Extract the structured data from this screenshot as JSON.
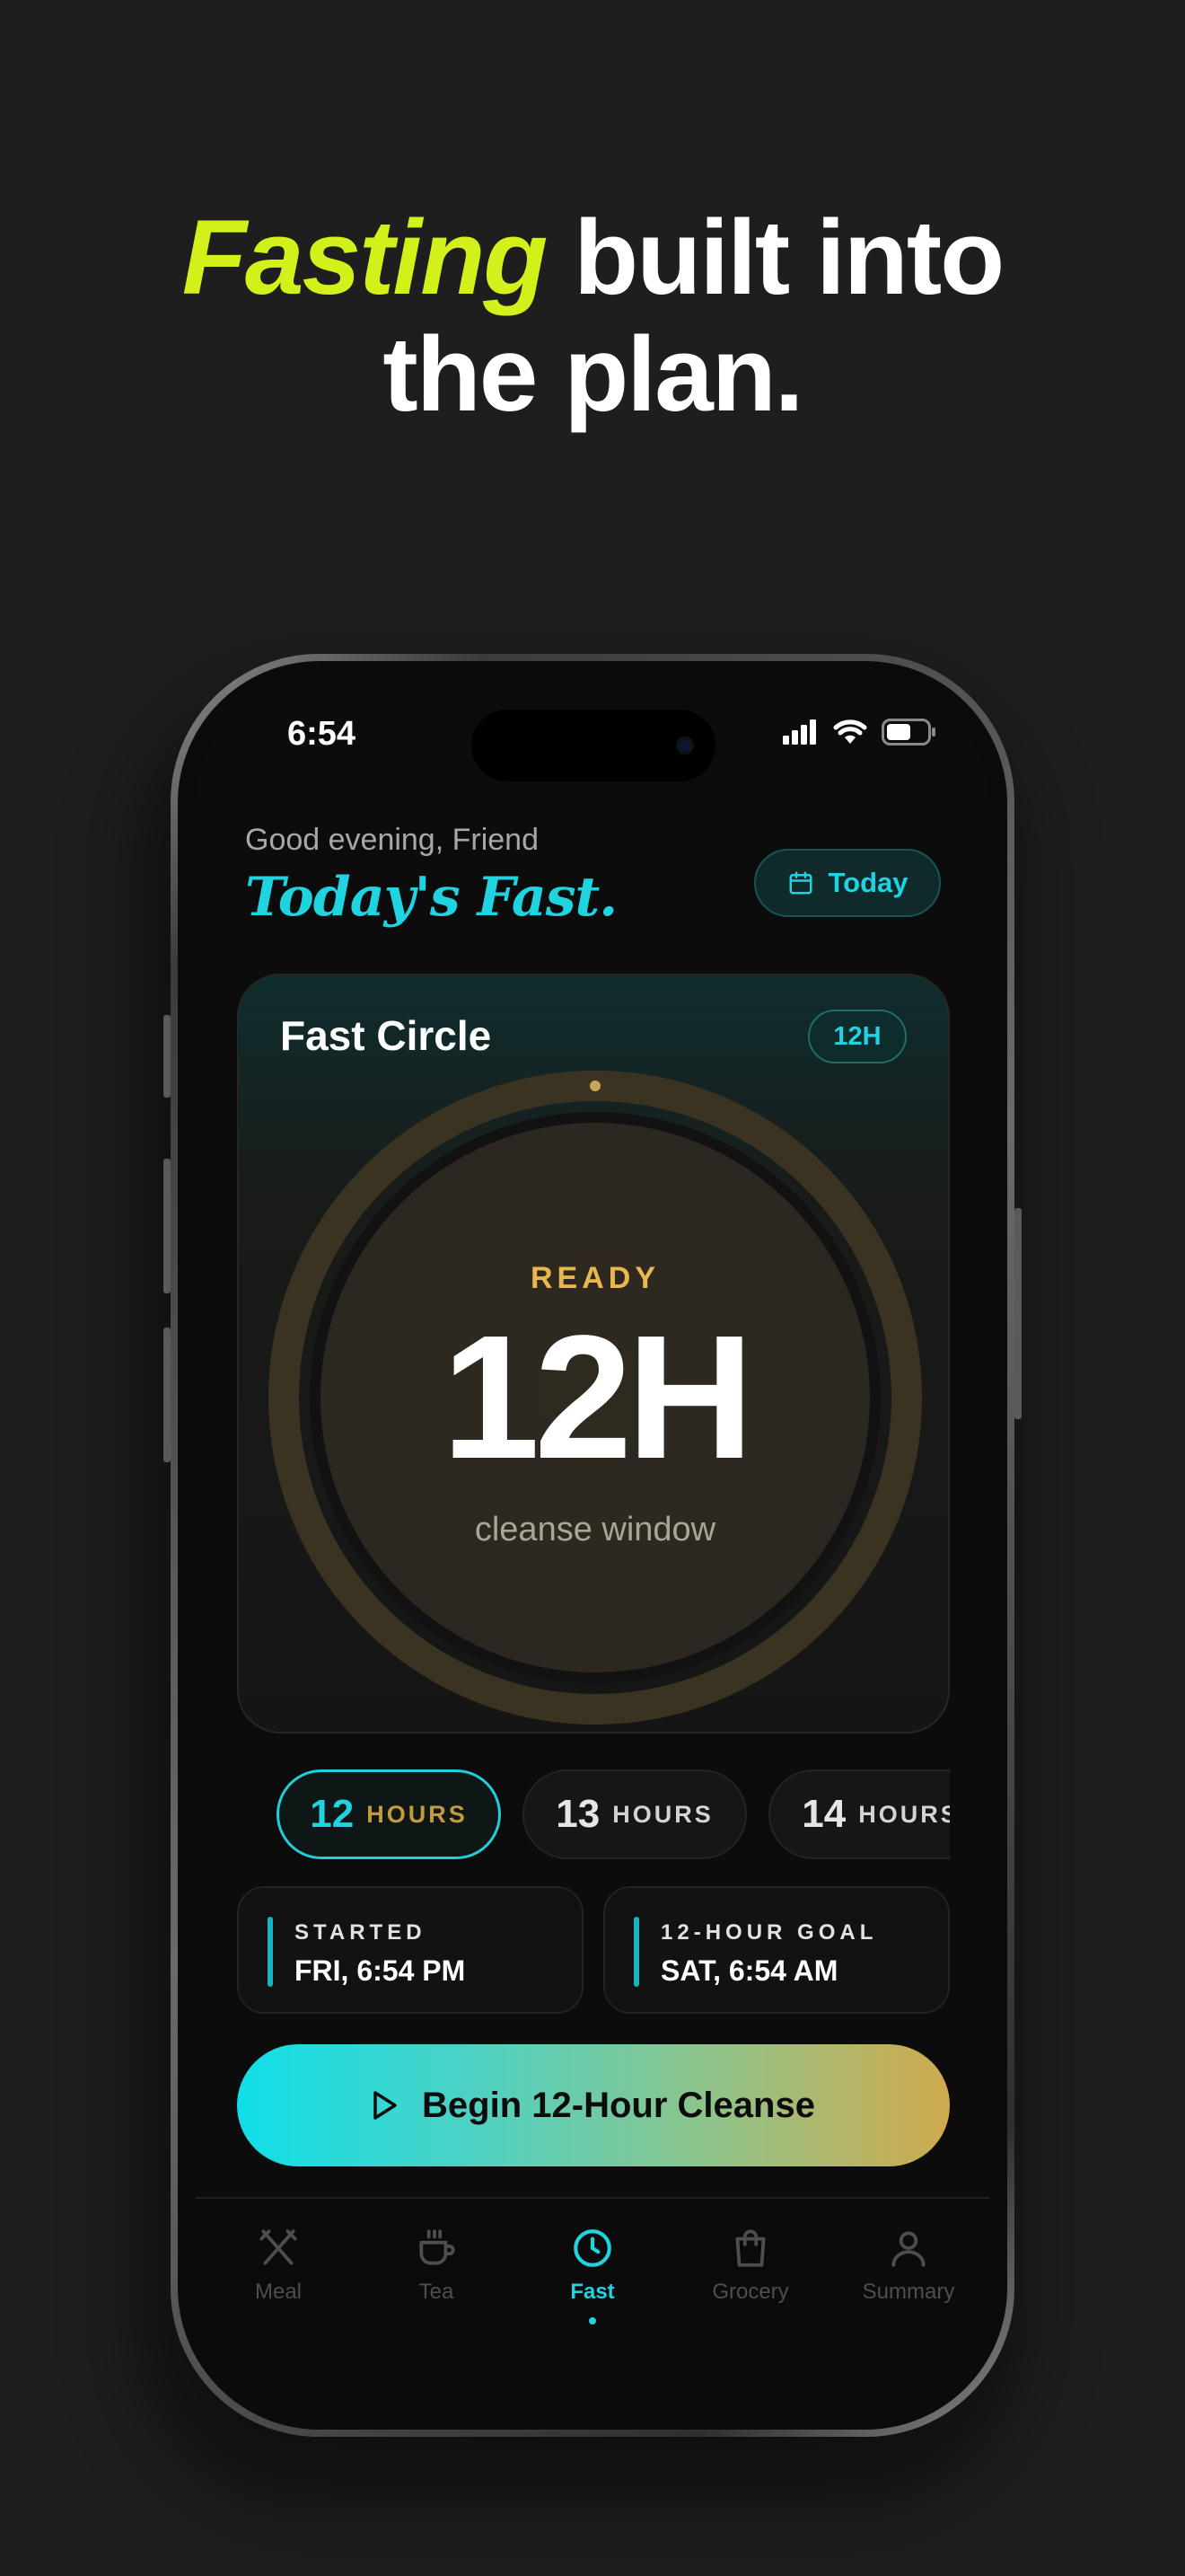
{
  "headline": {
    "accent": "Fasting",
    "line1_rest": " built into",
    "line2": "the plan."
  },
  "status_bar": {
    "time": "6:54",
    "icons": [
      "cellular-signal-icon",
      "wifi-icon",
      "battery-icon"
    ]
  },
  "header": {
    "greeting": "Good evening, Friend",
    "title": "Today's Fast.",
    "today_button": "Today",
    "today_icon": "calendar-icon"
  },
  "fast_circle": {
    "title": "Fast Circle",
    "badge": "12H",
    "status": "READY",
    "hours": "12H",
    "caption": "cleanse window",
    "progress": 0
  },
  "duration_options": [
    {
      "number": "12",
      "unit": "HOURS",
      "selected": true
    },
    {
      "number": "13",
      "unit": "HOURS",
      "selected": false
    },
    {
      "number": "14",
      "unit": "HOURS",
      "selected": false
    }
  ],
  "schedule": {
    "started_label": "STARTED",
    "started_value": "FRI, 6:54 PM",
    "goal_label": "12-HOUR GOAL",
    "goal_value": "SAT, 6:54 AM"
  },
  "cta": {
    "label": "Begin 12-Hour Cleanse",
    "icon": "play-icon"
  },
  "tabs": [
    {
      "label": "Meal",
      "icon": "utensils-icon",
      "active": false
    },
    {
      "label": "Tea",
      "icon": "tea-cup-icon",
      "active": false
    },
    {
      "label": "Fast",
      "icon": "clock-icon",
      "active": true
    },
    {
      "label": "Grocery",
      "icon": "shopping-bag-icon",
      "active": false
    },
    {
      "label": "Summary",
      "icon": "person-icon",
      "active": false
    }
  ],
  "colors": {
    "accent_lime": "#d4f01b",
    "accent_cyan": "#1fd3e0",
    "accent_gold": "#e8b84e",
    "background": "#1e1e1e"
  }
}
